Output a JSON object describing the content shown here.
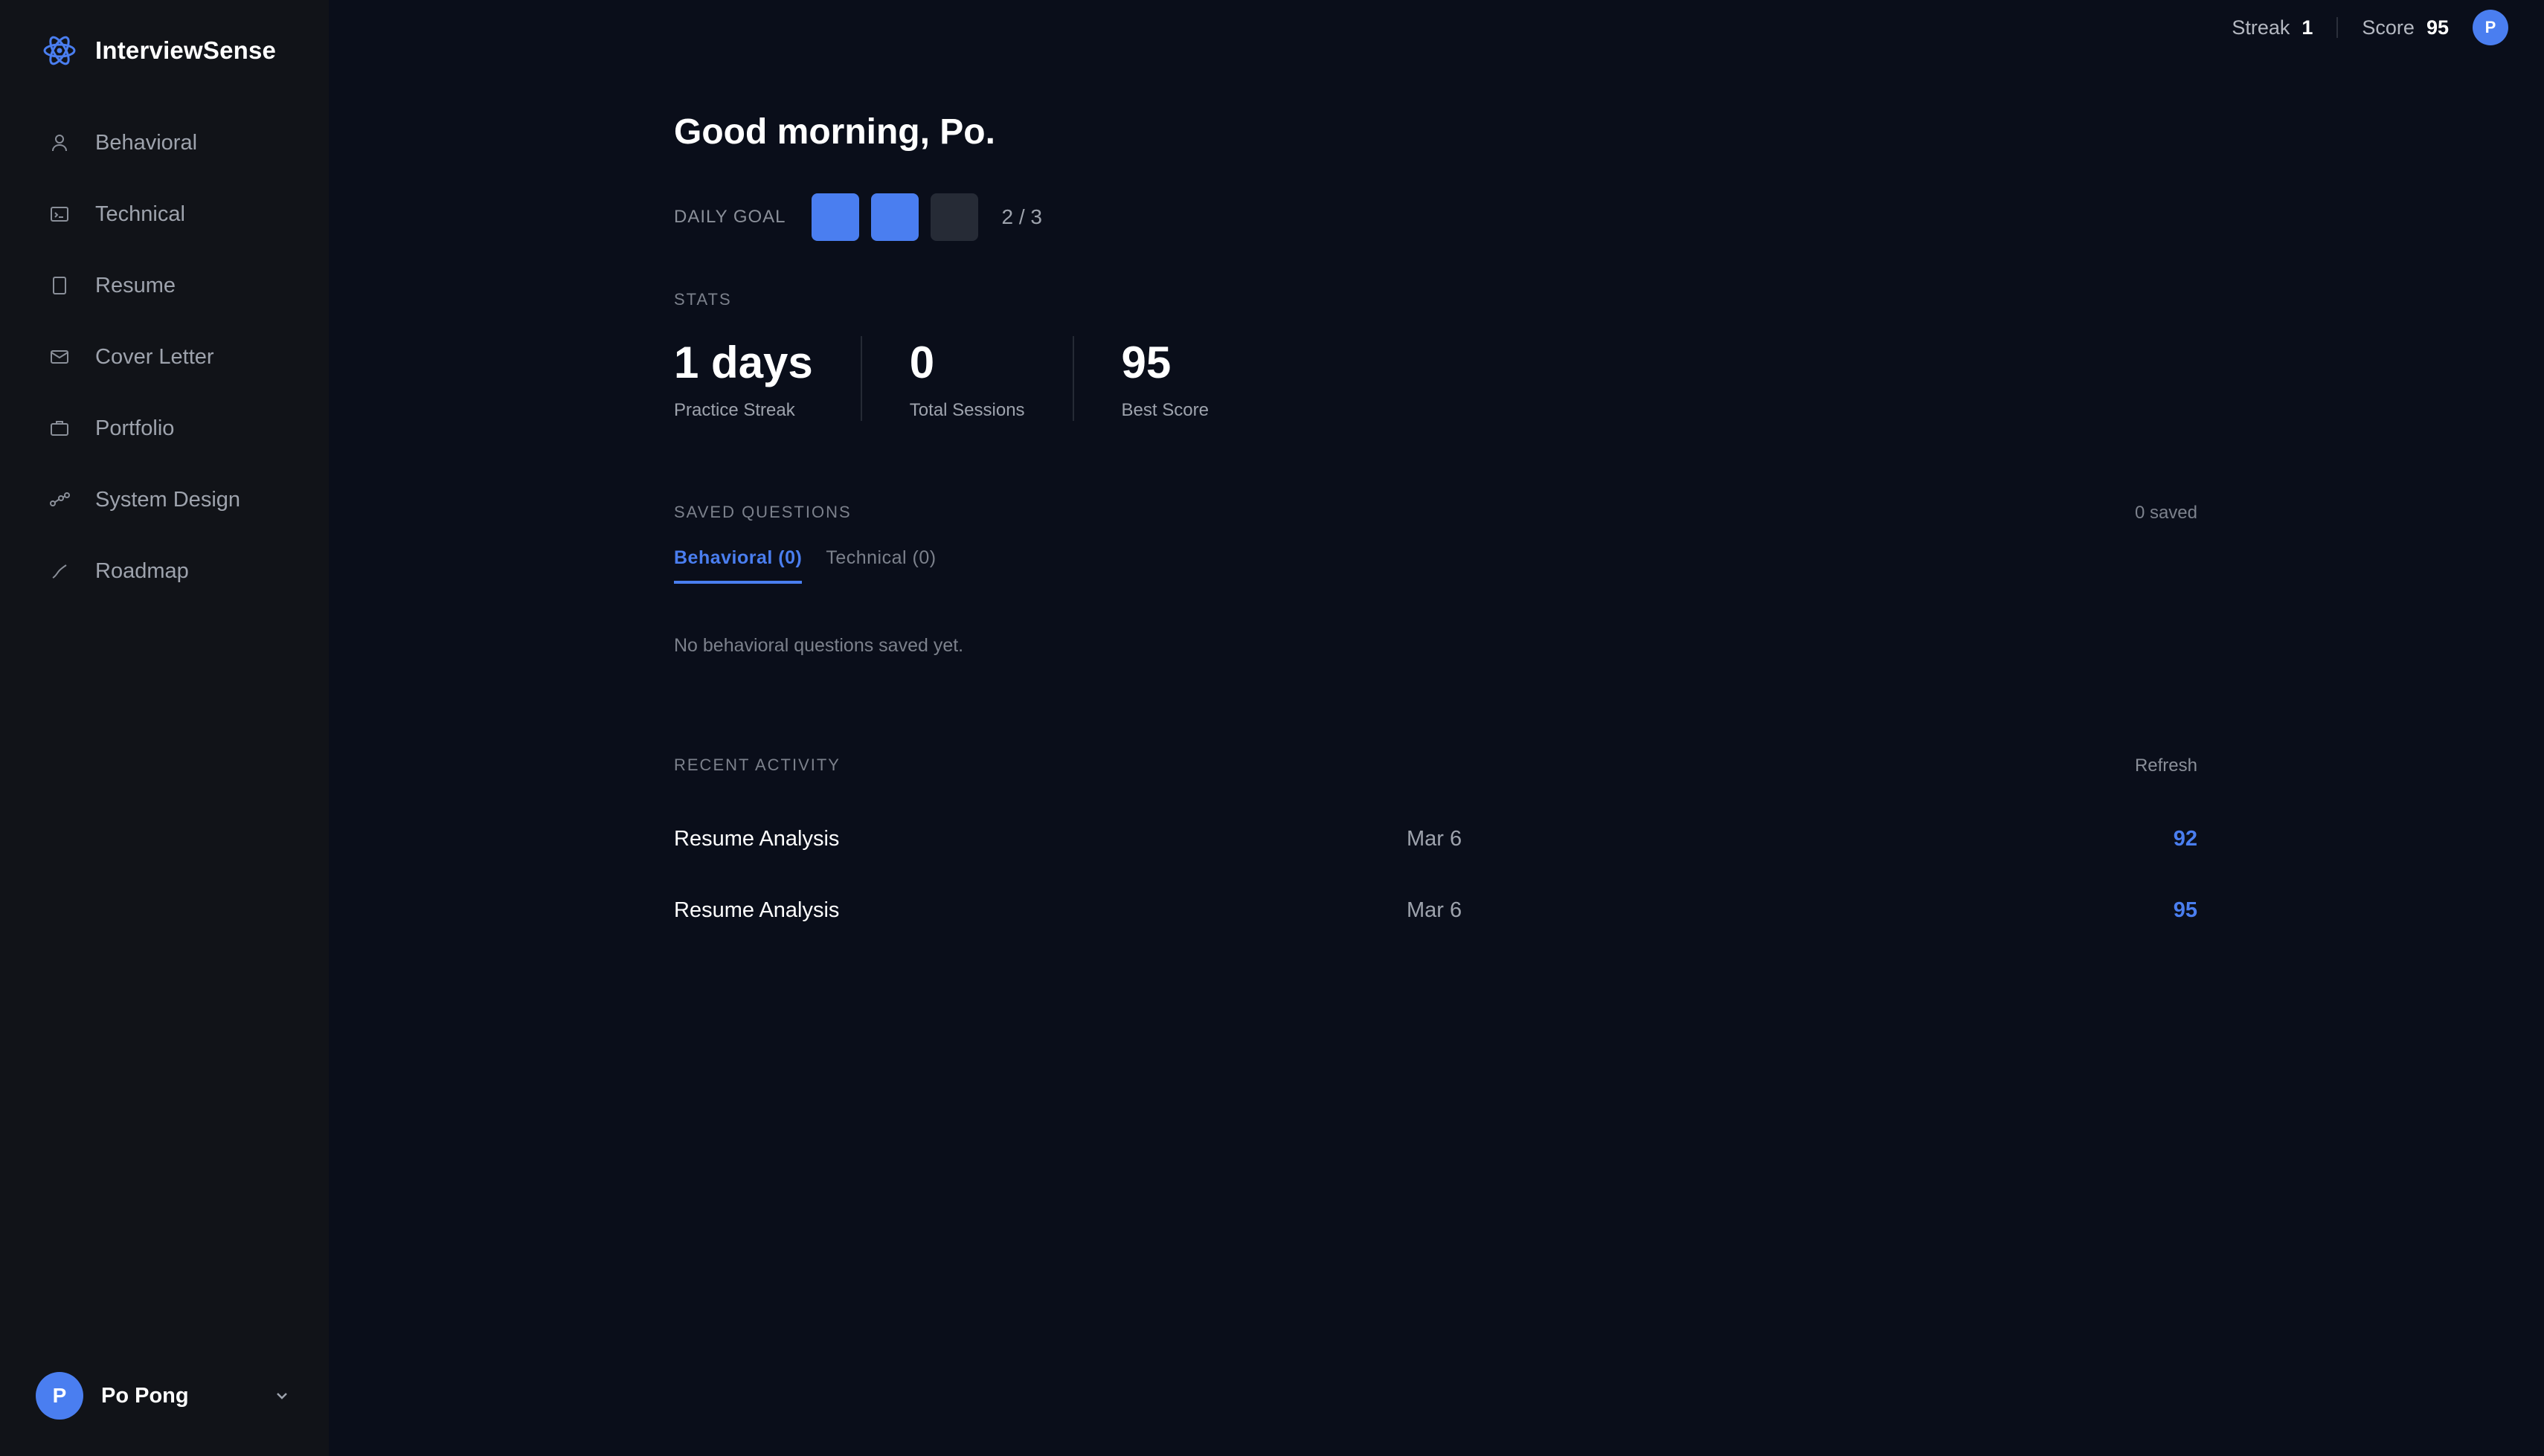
{
  "app": {
    "name": "InterviewSense",
    "logo_icon": "atom-logo-icon"
  },
  "sidebar": {
    "items": [
      {
        "label": "Behavioral",
        "icon": "person-icon"
      },
      {
        "label": "Technical",
        "icon": "terminal-icon"
      },
      {
        "label": "Resume",
        "icon": "document-icon"
      },
      {
        "label": "Cover Letter",
        "icon": "mail-icon"
      },
      {
        "label": "Portfolio",
        "icon": "briefcase-icon"
      },
      {
        "label": "System Design",
        "icon": "nodes-icon"
      },
      {
        "label": "Roadmap",
        "icon": "trend-icon"
      }
    ],
    "user": {
      "initial": "P",
      "name": "Po Pong"
    }
  },
  "topbar": {
    "streak_label": "Streak",
    "streak_value": "1",
    "score_label": "Score",
    "score_value": "95",
    "avatar_initial": "P"
  },
  "main": {
    "greeting": "Good morning, Po.",
    "daily_goal": {
      "label": "DAILY GOAL",
      "completed": 2,
      "total": 3,
      "text": "2 / 3"
    },
    "stats": {
      "label": "STATS",
      "items": [
        {
          "value": "1 days",
          "caption": "Practice Streak"
        },
        {
          "value": "0",
          "caption": "Total Sessions"
        },
        {
          "value": "95",
          "caption": "Best Score"
        }
      ]
    },
    "saved_questions": {
      "label": "SAVED QUESTIONS",
      "count_text": "0 saved",
      "tabs": [
        {
          "label": "Behavioral (0)",
          "active": true
        },
        {
          "label": "Technical (0)",
          "active": false
        }
      ],
      "empty_message": "No behavioral questions saved yet."
    },
    "recent_activity": {
      "label": "RECENT ACTIVITY",
      "refresh_label": "Refresh",
      "rows": [
        {
          "title": "Resume Analysis",
          "date": "Mar 6",
          "score": "92"
        },
        {
          "title": "Resume Analysis",
          "date": "Mar 6",
          "score": "95"
        }
      ]
    }
  },
  "colors": {
    "background": "#0a0e1a",
    "sidebar": "#111318",
    "accent": "#4a7ef0",
    "muted_text": "#9ea3ad"
  }
}
